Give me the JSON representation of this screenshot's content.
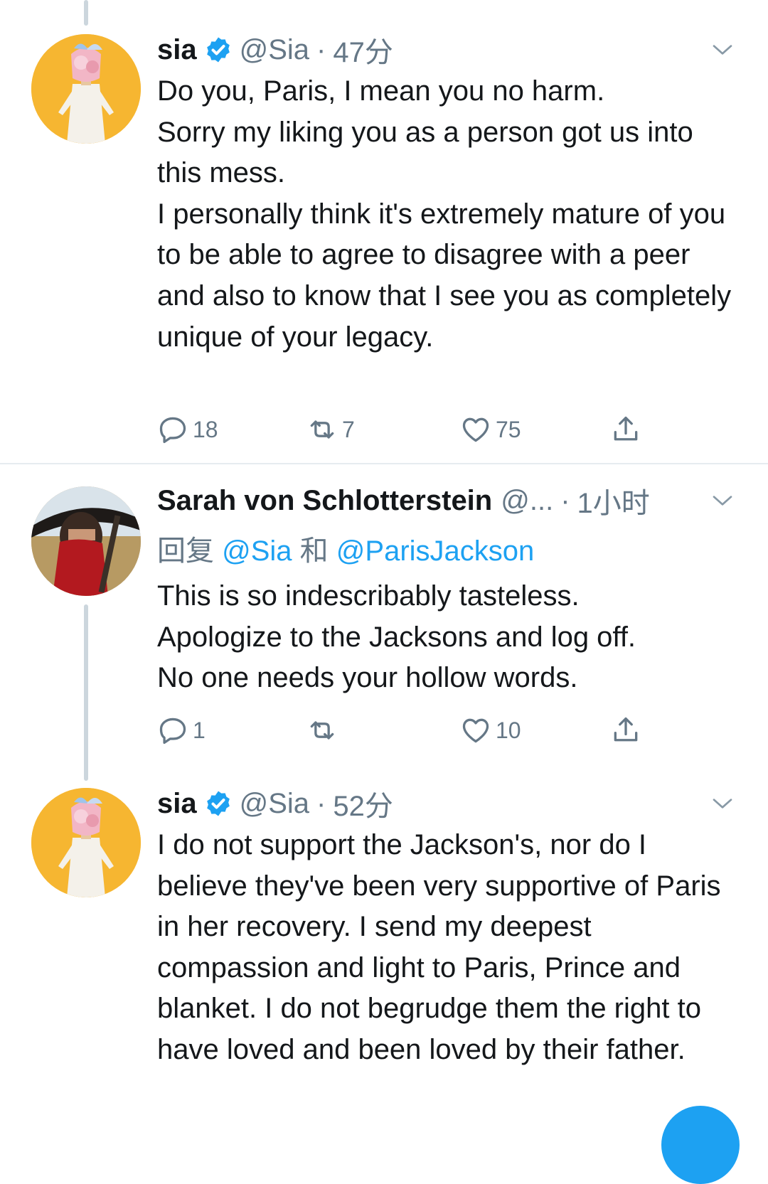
{
  "colors": {
    "accent": "#1da1f2",
    "secondary_text": "#657786",
    "divider": "#e6ecf0"
  },
  "tweets": [
    {
      "name": "sia",
      "handle": "@Sia",
      "separator": "·",
      "time": "47分",
      "text": "Do you, Paris, I mean you no harm.\nSorry my liking you as a person got us into this mess.\nI personally think it's extremely mature of you to be able to agree to disagree with a peer and also to know that I see you as completely unique of your legacy.",
      "reply_count": "18",
      "retweet_count": "7",
      "like_count": "75"
    },
    {
      "name": "Sarah von Schlotterstein",
      "handle": "@...",
      "separator": "·",
      "time": "1小时",
      "reply_prefix": "回复",
      "reply_user1": "@Sia",
      "reply_and": "和",
      "reply_user2": "@ParisJackson",
      "text": "This is so indescribably tasteless.\nApologize to the Jacksons and log off.\nNo one needs your hollow words.",
      "reply_count": "1",
      "retweet_count": "",
      "like_count": "10"
    },
    {
      "name": "sia",
      "handle": "@Sia",
      "separator": "·",
      "time": "52分",
      "text": "I do not support the Jackson's, nor do I believe they've been very supportive of Paris in her recovery. I send my deepest compassion and light to Paris, Prince and blanket. I do not begrudge them the right to have loved and been loved by their father."
    }
  ]
}
